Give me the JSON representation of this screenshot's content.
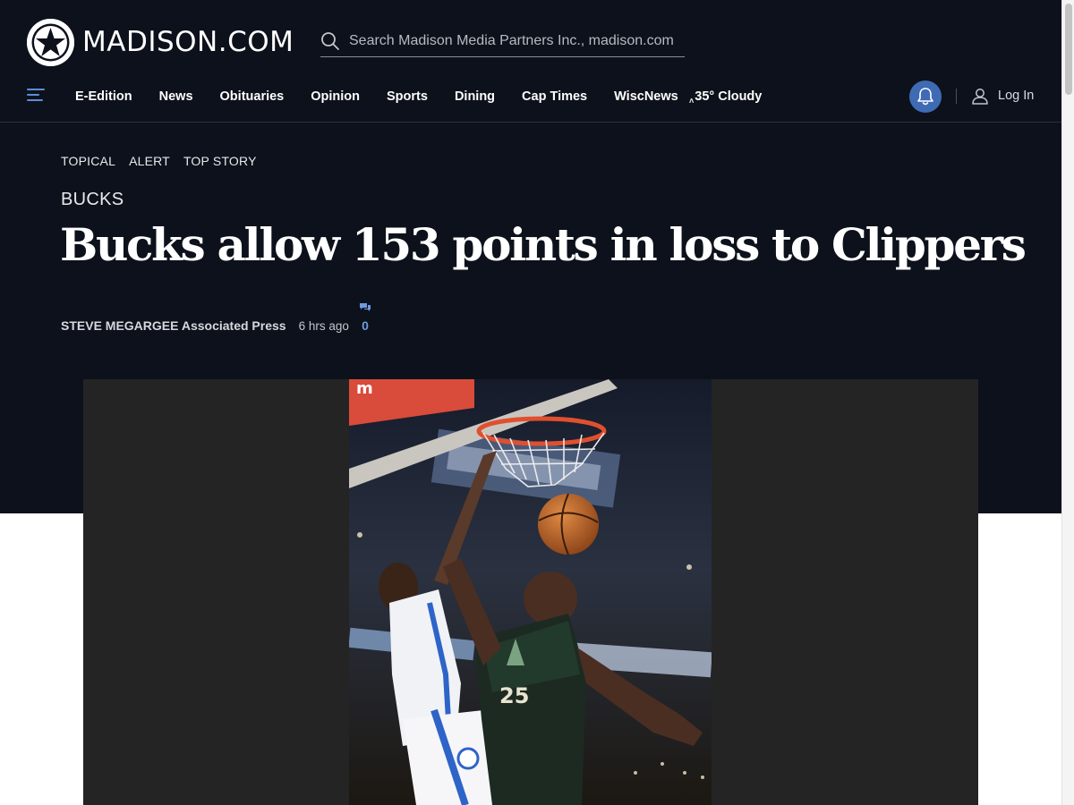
{
  "site": {
    "logo_text": "MADISON.COM",
    "search_placeholder": "Search Madison Media Partners Inc., madison.com"
  },
  "nav": {
    "items": [
      "E-Edition",
      "News",
      "Obituaries",
      "Opinion",
      "Sports",
      "Dining",
      "Cap Times",
      "WiscNews"
    ],
    "weather": "35° Cloudy",
    "login_label": "Log In"
  },
  "article": {
    "tags": [
      "TOPICAL",
      "ALERT",
      "TOP STORY"
    ],
    "section": "BUCKS",
    "headline": "Bucks allow 153 points in loss to Clippers",
    "author": "STEVE MEGARGEE Associated Press",
    "timestamp": "6 hrs ago",
    "comment_count": "0",
    "photo": {
      "jersey_number": "25",
      "backboard_text": "m"
    }
  },
  "colors": {
    "header_bg": "#0d111b",
    "accent_blue": "#3f6bb5",
    "link_blue": "#6e9be0",
    "photo_frame": "#242424"
  },
  "icons": [
    "star-logo-icon",
    "search-icon",
    "menu-icon",
    "weather-cloud-icon",
    "bell-icon",
    "user-icon",
    "comment-icon"
  ]
}
